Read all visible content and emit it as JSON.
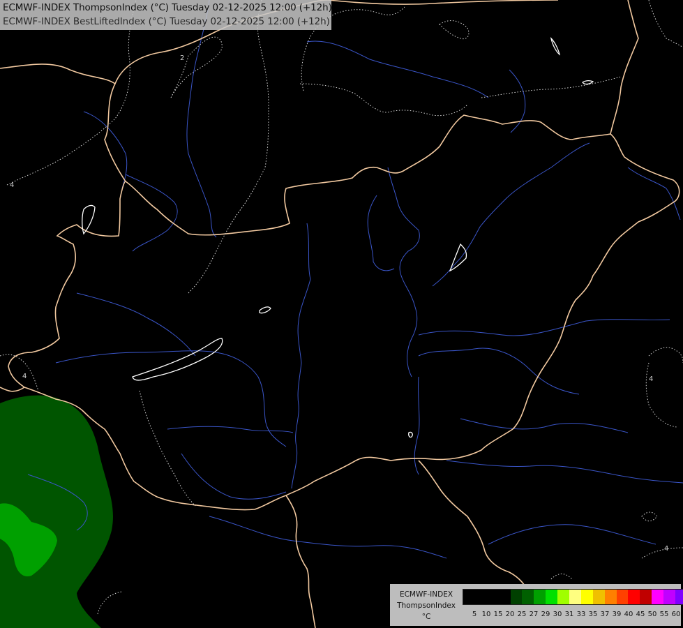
{
  "header": {
    "line1": "ECMWF-INDEX ThompsonIndex (°C) Tuesday 02-12-2025 12:00 (+12h)",
    "line2": "ECMWF-INDEX BestLiftedIndex (°C) Tuesday 02-12-2025 12:00 (+12h)"
  },
  "contour_labels": [
    "4",
    "4",
    "4",
    "4",
    "2"
  ],
  "legend": {
    "title1": "ECMWF-INDEX",
    "title2": "ThompsonIndex",
    "title3": "°C",
    "colors": [
      "#000000",
      "#000000",
      "#000000",
      "#000000",
      "#004000",
      "#006000",
      "#00a000",
      "#00e000",
      "#a0ff00",
      "#ffff80",
      "#ffff00",
      "#f0c000",
      "#ff8000",
      "#ff4000",
      "#ff0000",
      "#c00000",
      "#ff00ff",
      "#c000ff",
      "#8000ff",
      "#6000ff",
      "#0000ff"
    ],
    "ticks": [
      "5",
      "10",
      "15",
      "20",
      "25",
      "27",
      "29",
      "30",
      "31",
      "33",
      "35",
      "37",
      "39",
      "40",
      "45",
      "50",
      "55",
      "60"
    ]
  }
}
